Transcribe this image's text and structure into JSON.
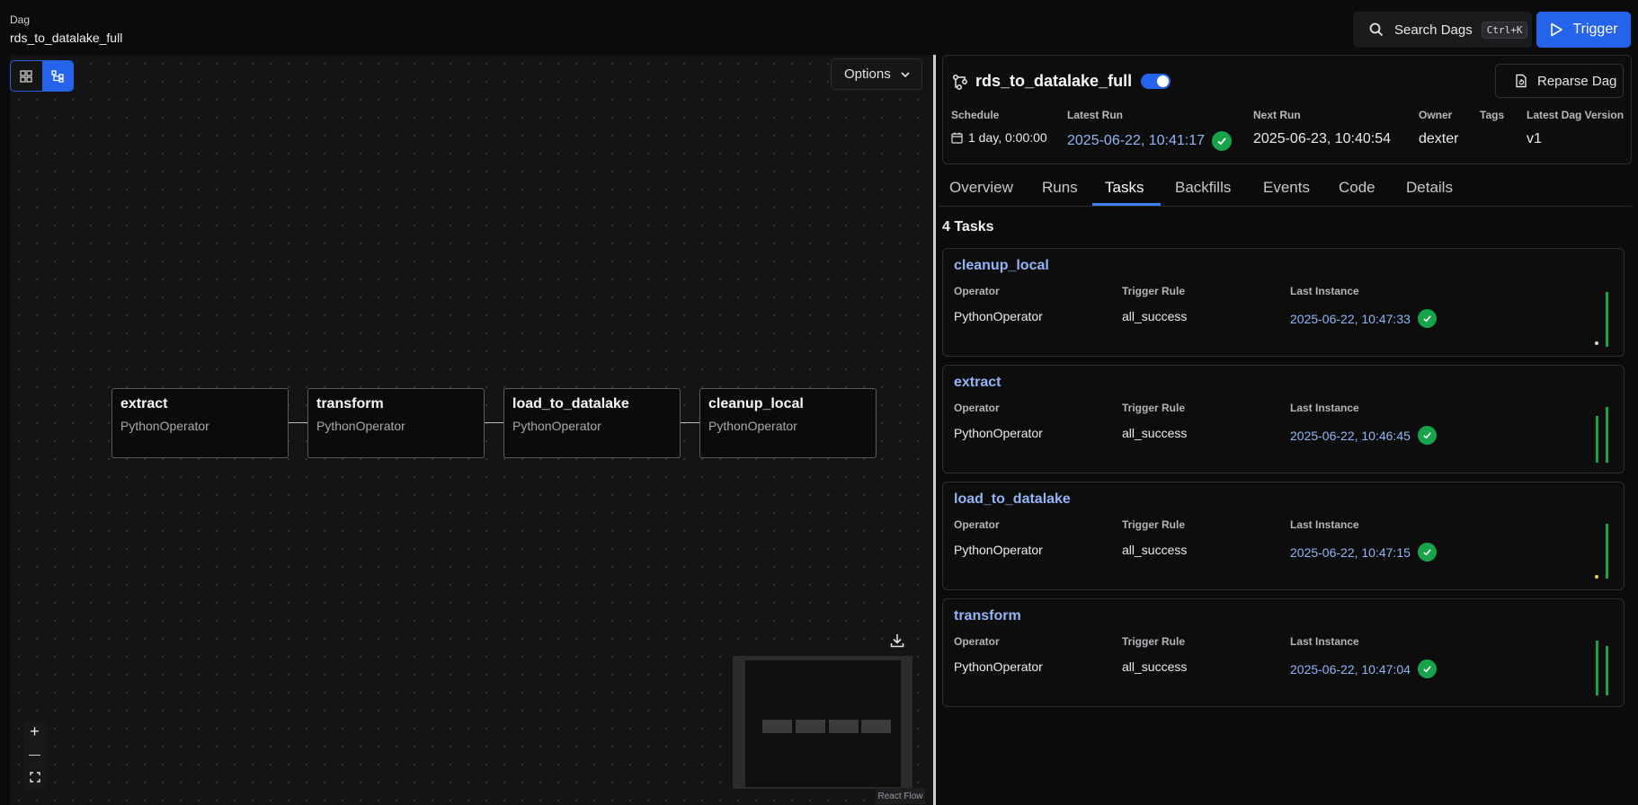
{
  "header": {
    "crumb_kind": "Dag",
    "crumb_name": "rds_to_datalake_full",
    "search_label": "Search Dags",
    "search_shortcut": "Ctrl+K",
    "trigger_label": "Trigger"
  },
  "graph": {
    "options_label": "Options",
    "nodes": [
      {
        "name": "extract",
        "operator": "PythonOperator"
      },
      {
        "name": "transform",
        "operator": "PythonOperator"
      },
      {
        "name": "load_to_datalake",
        "operator": "PythonOperator"
      },
      {
        "name": "cleanup_local",
        "operator": "PythonOperator"
      }
    ],
    "attribution": "React Flow",
    "zoom_in": "+",
    "zoom_out": "—"
  },
  "dag": {
    "title": "rds_to_datalake_full",
    "paused": false,
    "reparse_label": "Reparse Dag",
    "schedule_label": "Schedule",
    "schedule_value": "1 day, 0:00:00",
    "latest_run_label": "Latest Run",
    "latest_run_value": "2025-06-22, 10:41:17",
    "next_run_label": "Next Run",
    "next_run_value": "2025-06-23, 10:40:54",
    "owner_label": "Owner",
    "owner_value": "dexter",
    "tags_label": "Tags",
    "version_label": "Latest Dag Version",
    "version_value": "v1"
  },
  "tabs": [
    "Overview",
    "Runs",
    "Tasks",
    "Backfills",
    "Events",
    "Code",
    "Details"
  ],
  "active_tab": "Tasks",
  "tasks": {
    "count_label": "4 Tasks",
    "col_operator": "Operator",
    "col_trigger": "Trigger Rule",
    "col_last": "Last Instance",
    "items": [
      {
        "name": "cleanup_local",
        "operator": "PythonOperator",
        "trigger_rule": "all_success",
        "last_instance": "2025-06-22, 10:47:33"
      },
      {
        "name": "extract",
        "operator": "PythonOperator",
        "trigger_rule": "all_success",
        "last_instance": "2025-06-22, 10:46:45"
      },
      {
        "name": "load_to_datalake",
        "operator": "PythonOperator",
        "trigger_rule": "all_success",
        "last_instance": "2025-06-22, 10:47:15"
      },
      {
        "name": "transform",
        "operator": "PythonOperator",
        "trigger_rule": "all_success",
        "last_instance": "2025-06-22, 10:47:04"
      }
    ]
  },
  "colors": {
    "accent": "#2563eb",
    "success": "#16a34a",
    "link": "#93b4f5",
    "background": "#0b0b0c"
  }
}
